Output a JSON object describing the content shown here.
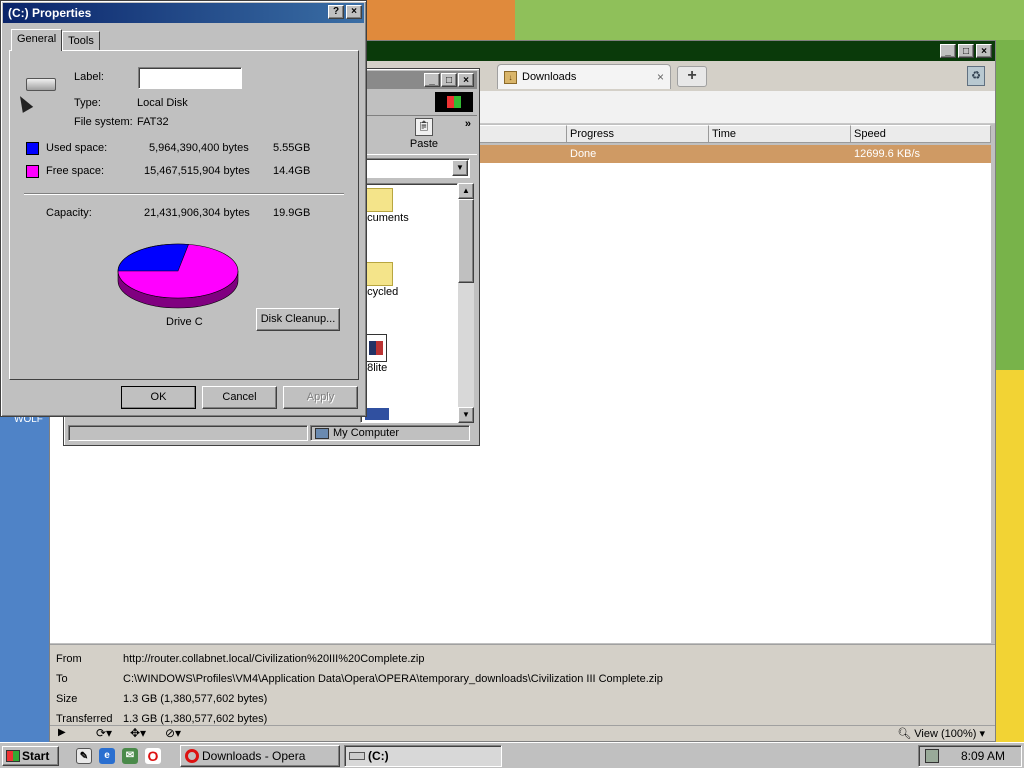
{
  "desktop": {
    "wallpaper_text": "WOLF"
  },
  "opera": {
    "tab_title": "Downloads",
    "tab_close": "×",
    "new_tab": "+",
    "columns": [
      "Progress",
      "Time",
      "Speed"
    ],
    "rows": [
      {
        "progress": "Done",
        "time": "",
        "speed": "12699.6 KB/s"
      }
    ],
    "details": [
      {
        "label": "From",
        "value": "http://router.collabnet.local/Civilization%20III%20Complete.zip"
      },
      {
        "label": "To",
        "value": "C:\\WINDOWS\\Profiles\\VM4\\Application Data\\Opera\\OPERA\\temporary_downloads\\Civilization III Complete.zip"
      },
      {
        "label": "Size",
        "value": "1.3 GB (1,380,577,602 bytes)"
      },
      {
        "label": "Transferred",
        "value": "1.3 GB (1,380,577,602 bytes)"
      }
    ],
    "zoom": "View (100%)",
    "accent": "#cf9a64"
  },
  "mycomputer": {
    "paste_label": "Paste",
    "chevron": "»",
    "items": [
      "ocuments",
      "ecycled",
      "98lite"
    ],
    "status": "My Computer"
  },
  "properties": {
    "title": "(C:) Properties",
    "help": "?",
    "close": "×",
    "tabs": [
      "General",
      "Tools"
    ],
    "label_label": "Label:",
    "label_value": "",
    "type_label": "Type:",
    "type_value": "Local Disk",
    "fs_label": "File system:",
    "fs_value": "FAT32",
    "used_label": "Used space:",
    "used_bytes": "5,964,390,400 bytes",
    "used_gb": "5.55GB",
    "free_label": "Free space:",
    "free_bytes": "15,467,515,904 bytes",
    "free_gb": "14.4GB",
    "cap_label": "Capacity:",
    "cap_bytes": "21,431,906,304 bytes",
    "cap_gb": "19.9GB",
    "drive_label": "Drive C",
    "cleanup_btn": "Disk Cleanup...",
    "ok_btn": "OK",
    "cancel_btn": "Cancel",
    "apply_btn": "Apply",
    "used_color": "#0000ff",
    "free_color": "#ff00ff",
    "used_fraction": 0.278
  },
  "taskbar": {
    "start": "Start",
    "tasks": [
      "Downloads - Opera",
      "(C:)"
    ],
    "clock": "8:09 AM"
  }
}
